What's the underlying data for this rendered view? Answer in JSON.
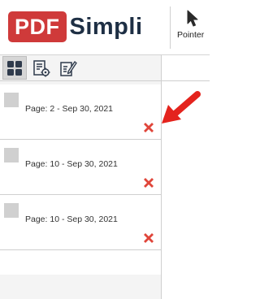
{
  "app": {
    "logo_pdf": "PDF",
    "logo_simpli": "Simpli"
  },
  "toolbar": {
    "pointer_label": "Pointer",
    "pointer_icon": "cursor-arrow-icon"
  },
  "sidebar": {
    "view_modes": [
      {
        "name": "thumbnails-view",
        "icon": "grid-icon",
        "active": true
      },
      {
        "name": "annotations-list-view",
        "icon": "list-settings-icon",
        "active": false
      },
      {
        "name": "edit-notes-view",
        "icon": "edit-note-icon",
        "active": false
      }
    ],
    "items": [
      {
        "label": "Page: 2 - Sep 30, 2021",
        "delete_icon": "delete-x-icon"
      },
      {
        "label": "Page: 10 - Sep 30, 2021",
        "delete_icon": "delete-x-icon"
      },
      {
        "label": "Page: 10 - Sep 30, 2021",
        "delete_icon": "delete-x-icon"
      }
    ]
  },
  "colors": {
    "brand_red": "#cf3a3a",
    "brand_navy": "#1e2f44",
    "delete_red": "#e0453a",
    "annotation_arrow": "#e4231d"
  }
}
